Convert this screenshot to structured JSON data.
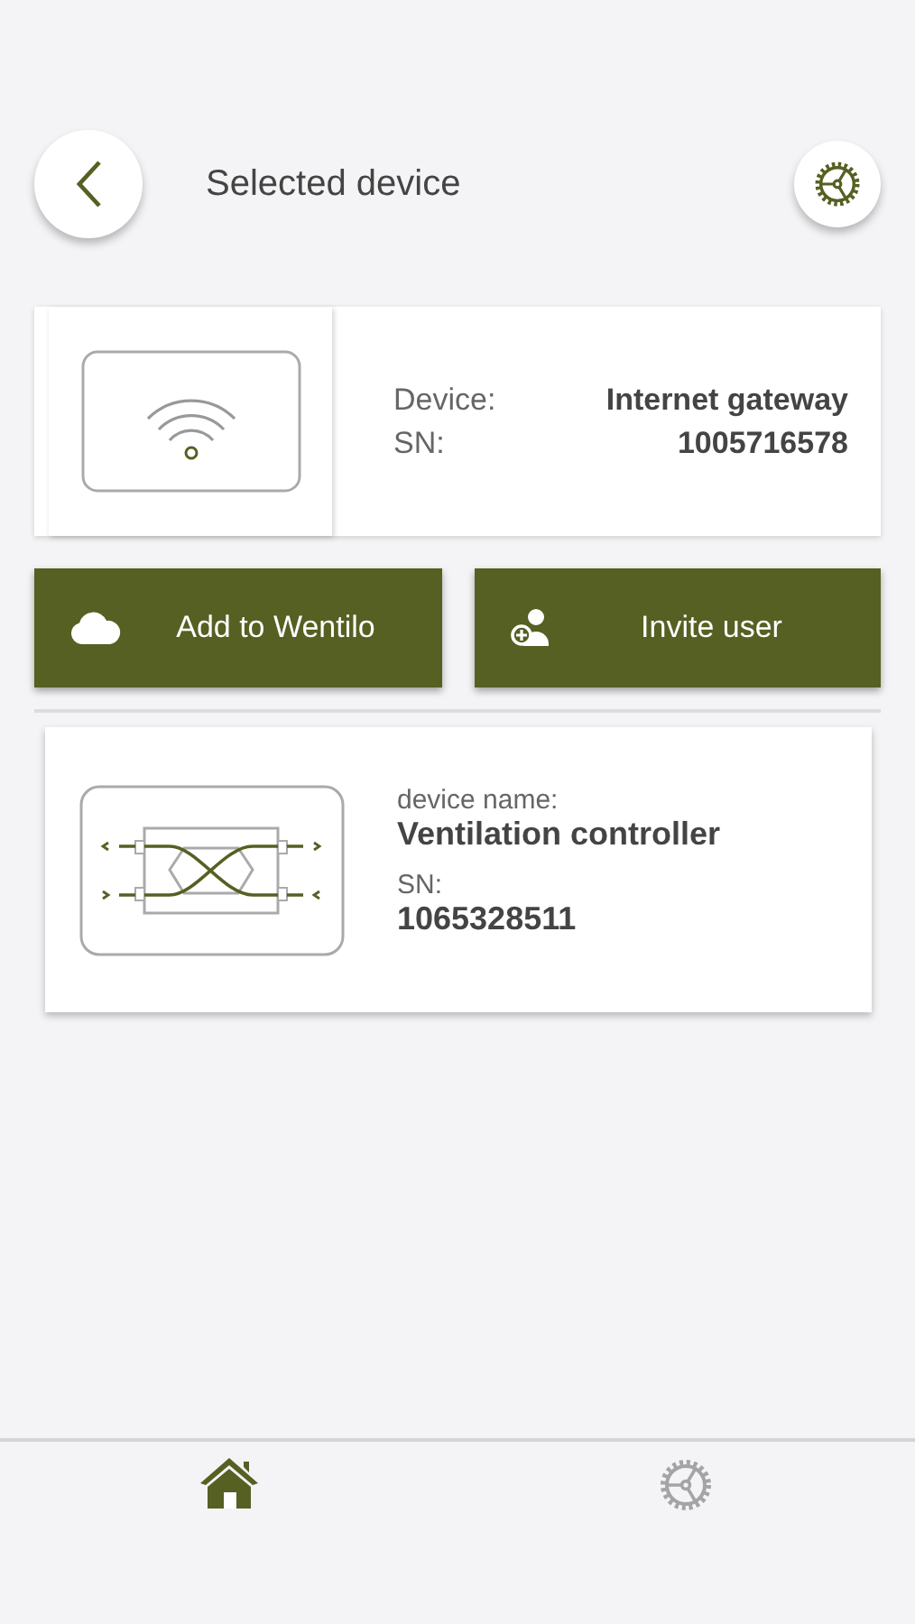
{
  "header": {
    "title": "Selected device"
  },
  "gateway": {
    "label_device": "Device:",
    "device": "Internet gateway",
    "label_sn": "SN:",
    "sn": "1005716578"
  },
  "buttons": [
    {
      "kind": "cloud",
      "label": "Add to Wentilo"
    },
    {
      "kind": "invite",
      "label": "Invite user"
    }
  ],
  "controller": {
    "label_name": "device name:",
    "name": "Ventilation controller",
    "label_sn": "SN:",
    "sn": "1065328511"
  },
  "tab_bar": [
    {
      "kind": "home",
      "selected": true
    },
    {
      "kind": "settings",
      "selected": false
    }
  ]
}
